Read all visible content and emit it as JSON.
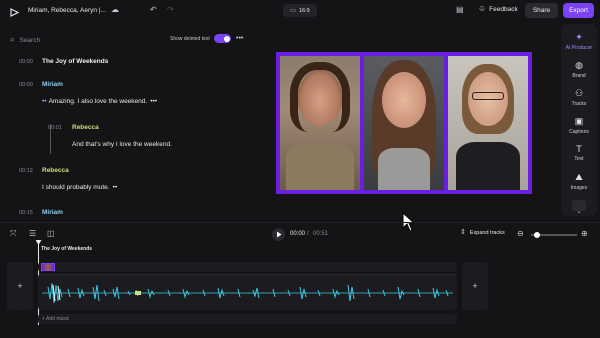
{
  "header": {
    "title": "Miriam, Rebecca, Aeryn |...",
    "aspect": "16:9",
    "feedback_label": "Feedback",
    "share_label": "Share",
    "export_label": "Export"
  },
  "transcript": {
    "search_placeholder": "Search",
    "show_deleted_label": "Show deleted text",
    "title_time": "00:00",
    "title": "The Joy of Weekends",
    "entries": [
      {
        "time": "00:00",
        "speaker": "Miriam",
        "text": "Amazing. I also love the weekend."
      },
      {
        "time": "00:01",
        "speaker": "Rebecca",
        "text": "And that's why I love the weekend."
      },
      {
        "time": "00:12",
        "speaker": "Rebecca",
        "text": "I should probably mute."
      },
      {
        "time": "00:15",
        "speaker": "Miriam",
        "text": ""
      }
    ]
  },
  "sidebar": {
    "items": [
      {
        "label": "AI Producer",
        "icon": "sparkle-icon"
      },
      {
        "label": "Brand",
        "icon": "palette-icon"
      },
      {
        "label": "Tracks",
        "icon": "people-icon"
      },
      {
        "label": "Captions",
        "icon": "captions-icon"
      },
      {
        "label": "Text",
        "icon": "text-icon"
      },
      {
        "label": "Images",
        "icon": "images-icon"
      }
    ]
  },
  "player": {
    "current_time": "00:00",
    "separator": "/",
    "total_time": "00:51",
    "expand_tracks_label": "Expand tracks"
  },
  "timeline": {
    "clip_title": "The Joy of Weekends",
    "add_music_label": "Add music"
  },
  "colors": {
    "accent": "#7b42f6",
    "frame": "#6a1fe0",
    "waveform": "#3ec6e0",
    "speaker_rebecca": "#c8e07a",
    "speaker_miriam": "#8fd0f0"
  }
}
